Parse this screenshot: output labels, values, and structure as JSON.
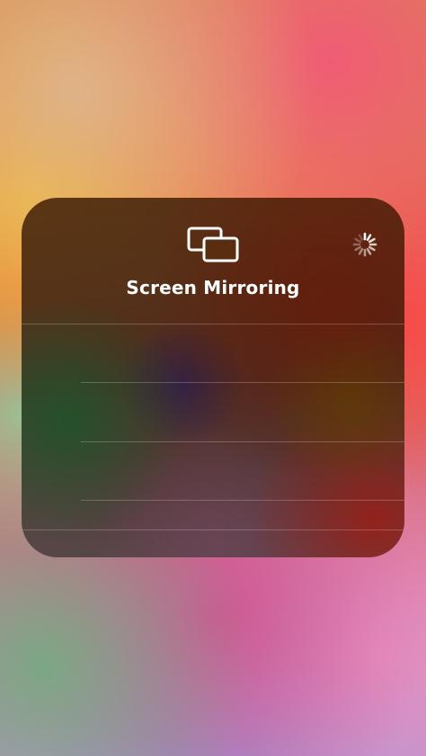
{
  "panel": {
    "title": "Screen Mirroring",
    "icons": {
      "mirroring": "screen-mirroring-icon",
      "loading": "loading-spinner-icon"
    }
  },
  "device_list": {
    "rows": 4
  },
  "colors": {
    "text": "#ffffff",
    "separator": "rgba(255,255,255,0.22)"
  }
}
